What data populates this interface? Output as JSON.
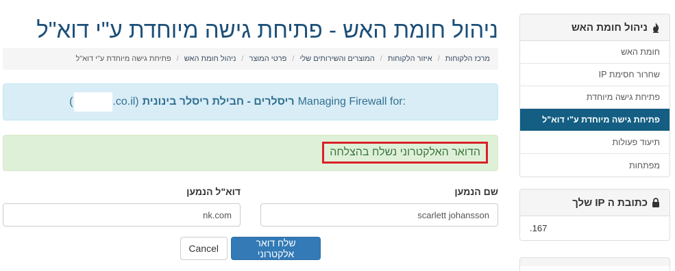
{
  "page_title": "ניהול חומת האש - פתיחת גישה מיוחדת ע\"י דוא\"ל",
  "breadcrumb": [
    {
      "label": "מרכז הלקוחות",
      "link": true
    },
    {
      "label": "איזור הלקוחות",
      "link": true
    },
    {
      "label": "המוצרים והשירותים שלי",
      "link": true
    },
    {
      "label": "פרטי המוצר",
      "link": true
    },
    {
      "label": "ניהול חומת האש",
      "link": true
    },
    {
      "label": "פתיחת גישה מיוחדת ע\"י דוא\"ל",
      "link": false
    }
  ],
  "info_alert": {
    "prefix": "Managing Firewall for:",
    "product": "ריסלרים - חבילת ריסלר בינונית",
    "domain_open": "(",
    "domain_suffix": ".co.il)"
  },
  "success_alert": {
    "message": "הדואר האלקטרוני נשלח בהצלחה"
  },
  "form": {
    "recipient_name_label": "שם הנמען",
    "recipient_name_value": "scarlett johansson",
    "recipient_email_label": "דוא\"ל הנמען",
    "recipient_email_value": "nk.com",
    "send_button_label": "שלח דואר אלקטרוני",
    "cancel_button_label": "Cancel"
  },
  "sidebar": {
    "firewall_panel": {
      "title": "ניהול חומת האש",
      "icon": "fire-icon",
      "items": [
        {
          "label": "חומת האש",
          "active": false
        },
        {
          "label": "שחרור חסימת IP",
          "active": false
        },
        {
          "label": "פתיחת גישה מיוחדת",
          "active": false
        },
        {
          "label": "פתיחת גישה מיוחדת ע\"י דוא\"ל",
          "active": true
        },
        {
          "label": "תיעוד פעולות",
          "active": false
        },
        {
          "label": "מפתחות",
          "active": false
        }
      ]
    },
    "ip_panel": {
      "title": "כתובת ה IP שלך",
      "icon": "lock-icon",
      "value": ".167"
    }
  },
  "colors": {
    "title": "#1c4f78",
    "active_menu": "#135e82",
    "primary_button": "#337ab7",
    "info_bg": "#d9edf7",
    "success_bg": "#dff0d8",
    "highlight_border": "#d92027"
  }
}
